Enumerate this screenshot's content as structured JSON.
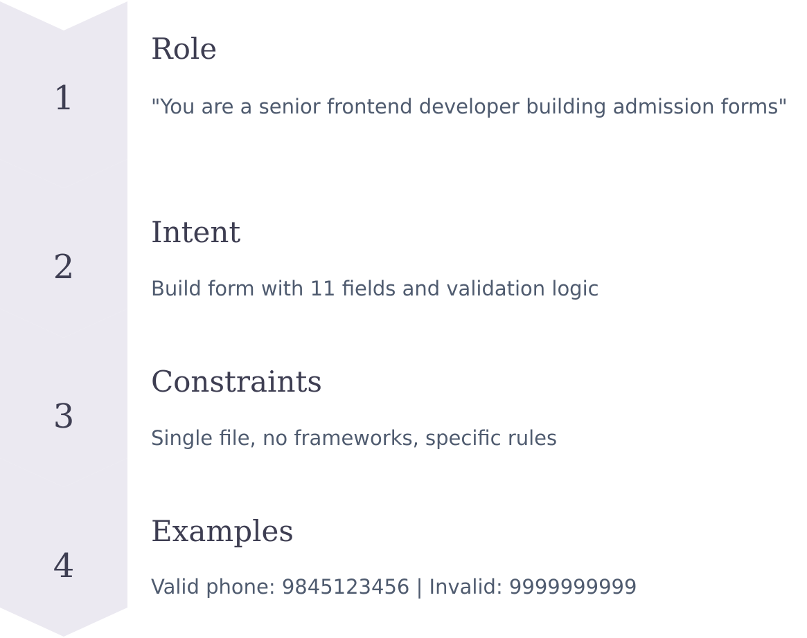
{
  "steps": [
    {
      "number": "1",
      "title": "Role",
      "description": "\"You are a senior frontend developer building admission forms\""
    },
    {
      "number": "2",
      "title": "Intent",
      "description": "Build form with 11 fields and validation logic"
    },
    {
      "number": "3",
      "title": "Constraints",
      "description": "Single file, no frameworks, specific rules"
    },
    {
      "number": "4",
      "title": "Examples",
      "description": "Valid phone: 9845123456 | Invalid: 9999999999"
    }
  ],
  "colors": {
    "chevron": "#ebe9f1",
    "title_text": "#3e3e52",
    "body_text": "#4f5b6f"
  }
}
